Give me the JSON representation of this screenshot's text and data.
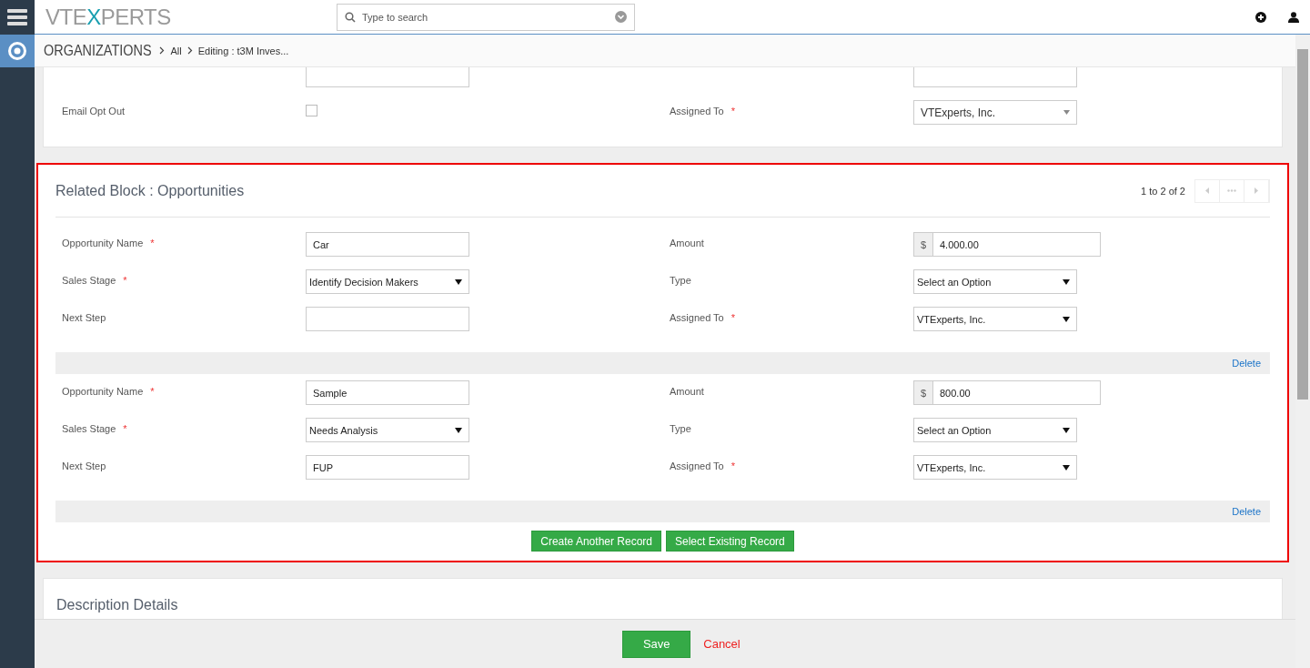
{
  "header": {
    "logo": [
      {
        "text": "VTE",
        "color": "#9a9a9a"
      },
      {
        "text": "X",
        "color": "#1a9fb0"
      },
      {
        "text": "PERTS",
        "color": "#9a9a9a"
      }
    ],
    "search": {
      "placeholder": "Type to search"
    }
  },
  "breadcrumb": [
    "ORGANIZATIONS",
    "All",
    "Editing : t3M Inves..."
  ],
  "top_block": {
    "fields": [
      {
        "kind": "text"
      },
      {
        "kind": "text"
      },
      {
        "kind": "checkbox",
        "label": "Email Opt Out",
        "checked": false
      },
      {
        "kind": "select",
        "label": "Assigned To",
        "required_mark": "*",
        "value": "VTExperts, Inc."
      }
    ]
  },
  "related_block": {
    "title": "Related Block : Opportunities",
    "pagination": "1 to 2 of 2",
    "records": [
      {
        "fields": [
          {
            "kind": "text",
            "label": "Opportunity Name",
            "required_mark": "*",
            "value": "Car"
          },
          {
            "kind": "currency",
            "label": "Amount",
            "symbol": "$",
            "value": "4.000.00"
          },
          {
            "kind": "dropdown",
            "label": "Sales Stage",
            "required_mark": "*",
            "value": "Identify Decision Makers"
          },
          {
            "kind": "dropdown",
            "label": "Type",
            "value": "Select an Option"
          },
          {
            "kind": "text",
            "label": "Next Step"
          },
          {
            "kind": "dropdown",
            "label": "Assigned To",
            "required_mark": "*",
            "value": "VTExperts, Inc."
          }
        ],
        "delete": "Delete"
      },
      {
        "fields": [
          {
            "kind": "text",
            "label": "Opportunity Name",
            "required_mark": "*",
            "value": "Sample"
          },
          {
            "kind": "currency",
            "label": "Amount",
            "symbol": "$",
            "value": "800.00"
          },
          {
            "kind": "dropdown",
            "label": "Sales Stage",
            "required_mark": "*",
            "value": "Needs Analysis"
          },
          {
            "kind": "dropdown",
            "label": "Type",
            "value": "Select an Option"
          },
          {
            "kind": "text",
            "label": "Next Step",
            "value": "FUP"
          },
          {
            "kind": "dropdown",
            "label": "Assigned To",
            "required_mark": "*",
            "value": "VTExperts, Inc."
          }
        ],
        "delete": "Delete"
      }
    ],
    "buttons": [
      "Create Another Record",
      "Select Existing Record"
    ]
  },
  "description_block": {
    "title": "Description Details"
  },
  "footer": {
    "save": "Save",
    "cancel": "Cancel"
  }
}
